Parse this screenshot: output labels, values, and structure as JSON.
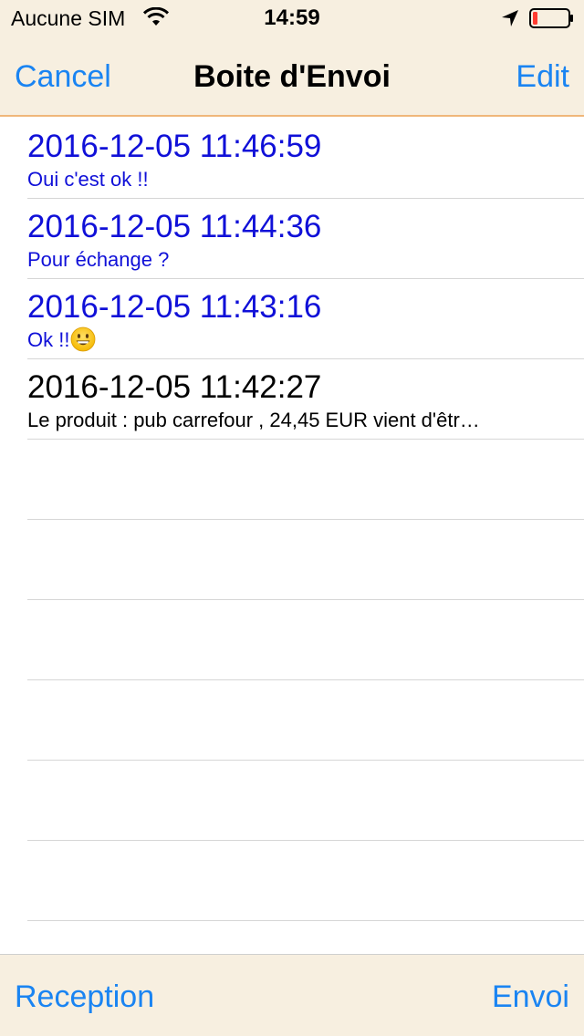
{
  "status_bar": {
    "carrier": "Aucune SIM",
    "time": "14:59",
    "icons": [
      "wifi-icon",
      "location-arrow-icon",
      "battery-low-icon"
    ]
  },
  "nav": {
    "left_label": "Cancel",
    "title": "Boite d'Envoi",
    "right_label": "Edit"
  },
  "messages": [
    {
      "date": "2016-12-05 11:46:59",
      "preview": "Oui c'est ok !!",
      "unread": true
    },
    {
      "date": "2016-12-05 11:44:36",
      "preview": "Pour échange ?",
      "unread": true
    },
    {
      "date": "2016-12-05 11:43:16",
      "preview": "Ok !!",
      "unread": true,
      "emoji": "grinning-face-icon"
    },
    {
      "date": "2016-12-05 11:42:27",
      "preview": "Le produit : pub carrefour , 24,45 EUR vient d'êtr…",
      "unread": false
    }
  ],
  "toolbar": {
    "left_label": "Reception",
    "right_label": "Envoi"
  },
  "colors": {
    "accent": "#1a84f2",
    "unread_text": "#1010d8",
    "bar_background": "#f7efe0",
    "nav_border": "#f0b77a",
    "battery_low": "#ff3b30"
  }
}
